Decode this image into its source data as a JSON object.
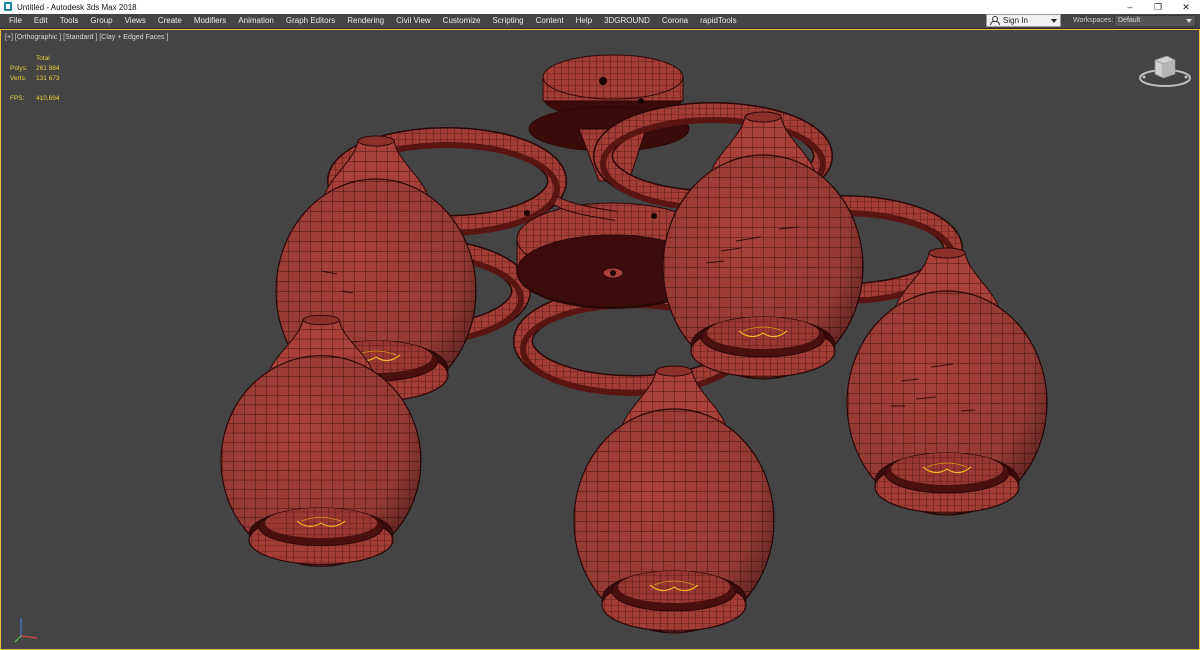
{
  "window": {
    "title": "Untitled - Autodesk 3ds Max 2018",
    "controls": {
      "minimize": "–",
      "restore": "❐",
      "close": "✕"
    }
  },
  "menu": [
    "File",
    "Edit",
    "Tools",
    "Group",
    "Views",
    "Create",
    "Modifiers",
    "Animation",
    "Graph Editors",
    "Rendering",
    "Civil View",
    "Customize",
    "Scripting",
    "Content",
    "Help",
    "3DGROUND",
    "Corona",
    "rapidTools"
  ],
  "signin": {
    "label": "Sign In"
  },
  "workspaces": {
    "label": "Workspaces:",
    "value": "Default"
  },
  "viewport": {
    "label": "[+] [Orthographic ] [Standard ] [Clay + Edged Faces ]",
    "stats": {
      "header": "Total",
      "polys_label": "Polys:",
      "polys_value": "261 984",
      "verts_label": "Verts:",
      "verts_value": "131 673",
      "fps_label": "FPS:",
      "fps_value": "410,694"
    },
    "clay_color": "#a8413b",
    "edge_color": "#2a0707",
    "background_color": "#444444",
    "active_border_color": "#e6c23a"
  },
  "icons": {
    "app": "3ds-max-icon",
    "user": "user-icon",
    "viewcube": "viewcube-icon",
    "axis": "axis-tripod-icon"
  }
}
